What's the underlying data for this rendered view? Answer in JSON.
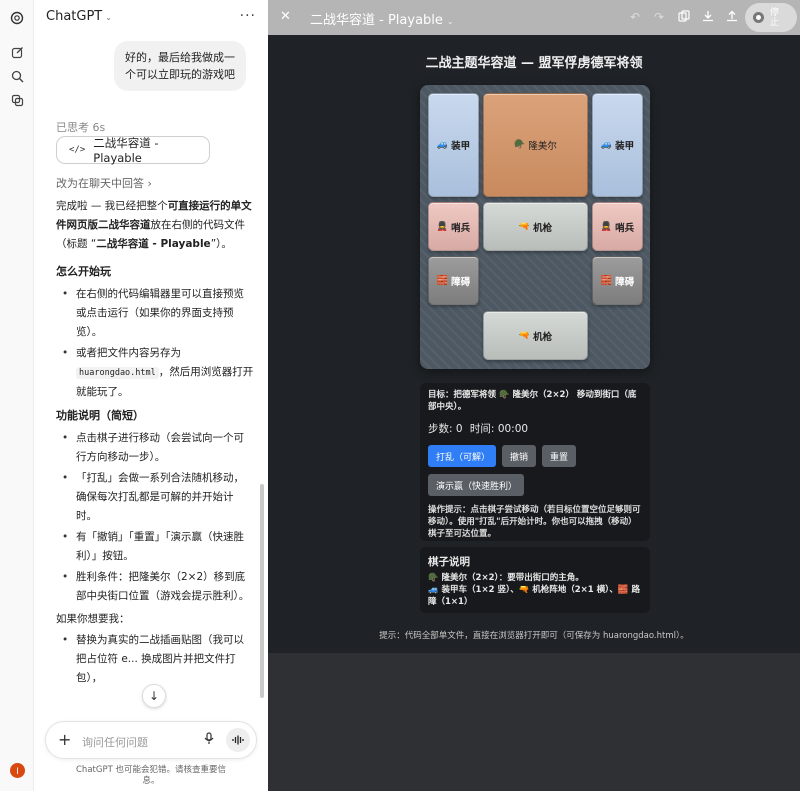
{
  "app": {
    "name": "ChatGPT"
  },
  "user_message": "好的，最后给我做成一个可以立即玩的游戏吧",
  "thinking": "已思考 6s",
  "artifact_pill": "二战华容道 - Playable",
  "answer_in_chat": "改为在聊天中回答",
  "reply": {
    "p1_a": "完成啦 — 我已经把整个",
    "p1_b": "可直接运行的单文件网页版二战华容道",
    "p1_c": "放在右侧的代码文件（标题 “",
    "p1_d": "二战华容道 - Playable",
    "p1_e": "”）。",
    "h_start": "怎么开始玩",
    "start_1": "在右侧的代码编辑器里可以直接预览或点击运行（如果你的界面支持预览）。",
    "start_2a": "或者把文件内容另存为 ",
    "start_2_code": "huarongdao.html",
    "start_2b": "，然后用浏览器打开就能玩了。",
    "h_features": "功能说明（简短）",
    "feat_1": "点击棋子进行移动（会尝试向一个可行方向移动一步）。",
    "feat_2": "「打乱」会做一系列合法随机移动，确保每次打乱都是可解的并开始计时。",
    "feat_3": "有「撤销」「重置」「演示赢（快速胜利）」按钮。",
    "feat_4": "胜利条件：把隆美尔（2×2）移到底部中央街口位置（游戏会提示胜利）。",
    "h_more": "如果你想要我：",
    "more_1": "替换为真实的二战插画贴图（我可以把占位符 e... 换成图片并把文件打包），"
  },
  "composer": {
    "placeholder": "询问任何问题"
  },
  "disclaimer": "ChatGPT 也可能会犯错。请核查重要信息。",
  "canvas": {
    "title": "二战华容道 - Playable",
    "stop_label": "停止",
    "game_title": "二战主题华容道 — 盟军俘虏德军将领",
    "pieces": {
      "armor": "装甲",
      "boss": "隆美尔",
      "sentry": "哨兵",
      "gun": "机枪",
      "block": "障碍"
    },
    "goal": "目标：把德军将领 🪖 隆美尔（2×2） 移动到街口（底部中央）。",
    "steps_label": "步数:",
    "steps_value": "0",
    "time_label": "时间:",
    "time_value": "00:00",
    "buttons": {
      "shuffle": "打乱（可解）",
      "undo": "撤销",
      "reset": "重置",
      "demo": "演示赢（快速胜利）"
    },
    "tip": "操作提示：点击棋子尝试移动（若目标位置空位足够则可移动）。使用\"打乱\"后开始计时。你也可以拖拽（移动）棋子至可达位置。",
    "legend_title": "棋子说明",
    "legend_line1": "🪖 隆美尔（2×2）：要带出街口的主角。",
    "legend_line2": "🚙 装甲车（1×2 竖）、🔫 机枪阵地（2×1 横）、🧱 路障（1×1）",
    "footer": "提示：代码全部单文件，直接在浏览器打开即可（可保存为 huarongdao.html）。"
  },
  "icons": {
    "boss": "🪖",
    "armor": "🚙",
    "sentry": "💂",
    "gun": "🔫",
    "block": "🧱"
  },
  "colors": {
    "primary_button": "#2f7ef5",
    "avatar": "#d9480f",
    "canvas_bg": "#1f2226"
  }
}
